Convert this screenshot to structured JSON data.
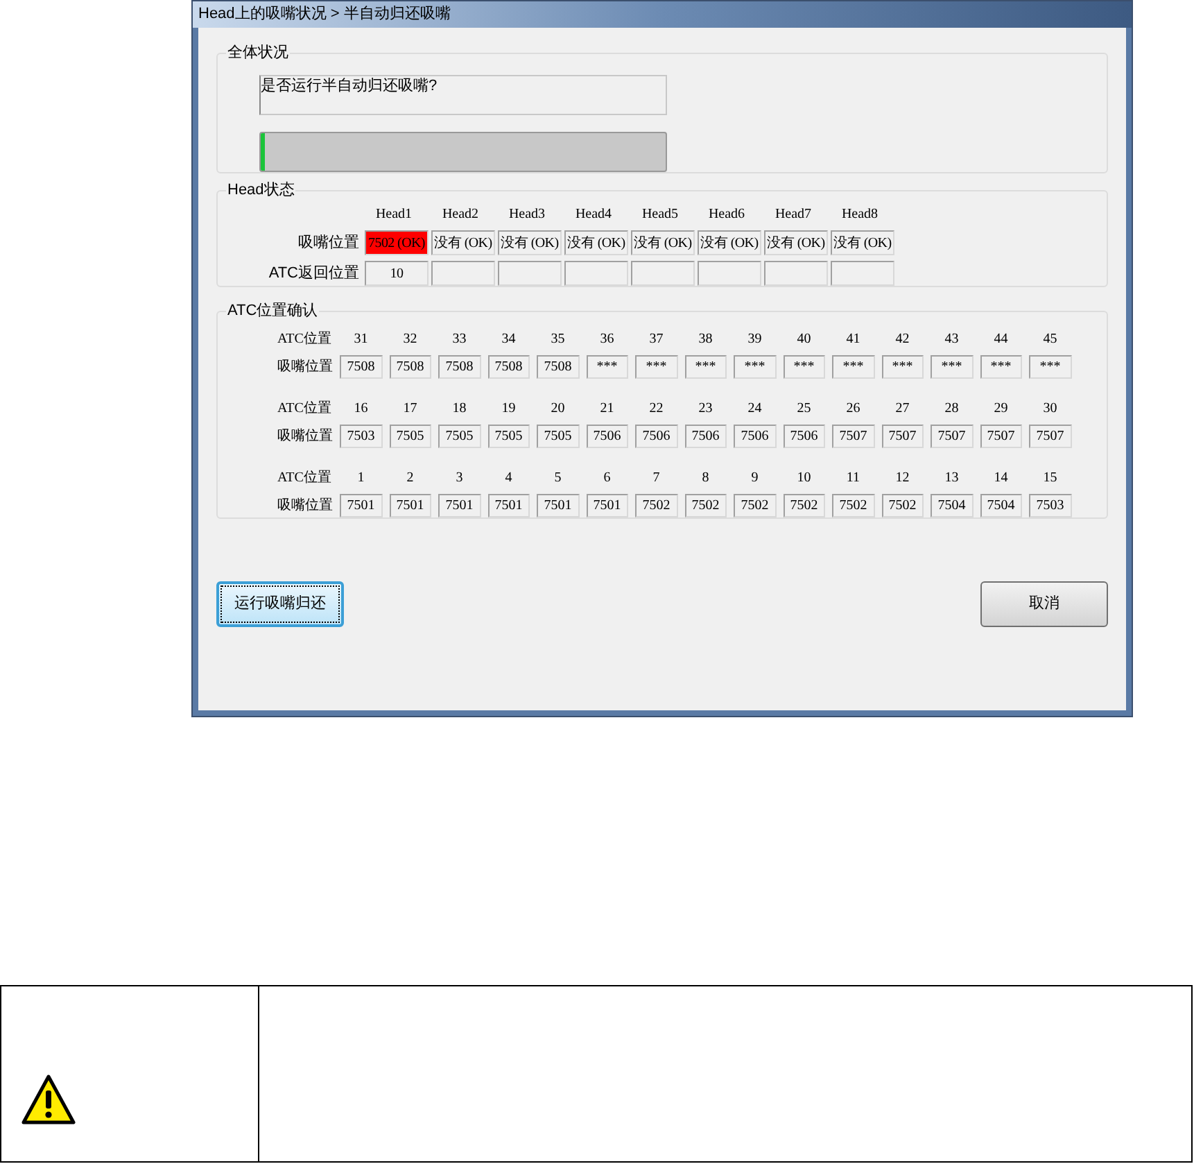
{
  "window": {
    "title": "Head上的吸嘴状况 > 半自动归还吸嘴"
  },
  "overall": {
    "label": "全体状况",
    "message": "是否运行半自动归还吸嘴?",
    "progress": {
      "level": 0.01
    }
  },
  "head_status": {
    "label": "Head状态",
    "row_labels": [
      "吸嘴位置",
      "ATC返回位置"
    ],
    "heads": [
      {
        "name": "Head1",
        "nozzle": "7502 (OK)",
        "alert": true,
        "atc_return": "10"
      },
      {
        "name": "Head2",
        "nozzle": "没有 (OK)",
        "alert": false
      },
      {
        "name": "Head3",
        "nozzle": "没有 (OK)",
        "alert": false
      },
      {
        "name": "Head4",
        "nozzle": "没有 (OK)",
        "alert": false
      },
      {
        "name": "Head5",
        "nozzle": "没有 (OK)",
        "alert": false
      },
      {
        "name": "Head6",
        "nozzle": "没有 (OK)",
        "alert": false
      },
      {
        "name": "Head7",
        "nozzle": "没有 (OK)",
        "alert": false
      },
      {
        "name": "Head8",
        "nozzle": "没有 (OK)",
        "alert": false
      }
    ]
  },
  "atc_check": {
    "label": "ATC位置确认",
    "groups": [
      {
        "atc_label": "ATC位置",
        "nozzle_label": "吸嘴位置",
        "slots": [
          {
            "atc": "31",
            "nozzle": "7508"
          },
          {
            "atc": "32",
            "nozzle": "7508"
          },
          {
            "atc": "33",
            "nozzle": "7508"
          },
          {
            "atc": "34",
            "nozzle": "7508"
          },
          {
            "atc": "35",
            "nozzle": "7508"
          },
          {
            "atc": "36",
            "nozzle": "***"
          },
          {
            "atc": "37",
            "nozzle": "***"
          },
          {
            "atc": "38",
            "nozzle": "***"
          },
          {
            "atc": "39",
            "nozzle": "***"
          },
          {
            "atc": "40",
            "nozzle": "***"
          },
          {
            "atc": "41",
            "nozzle": "***"
          },
          {
            "atc": "42",
            "nozzle": "***"
          },
          {
            "atc": "43",
            "nozzle": "***"
          },
          {
            "atc": "44",
            "nozzle": "***"
          },
          {
            "atc": "45",
            "nozzle": "***"
          }
        ]
      },
      {
        "atc_label": "ATC位置",
        "nozzle_label": "吸嘴位置",
        "slots": [
          {
            "atc": "16",
            "nozzle": "7503"
          },
          {
            "atc": "17",
            "nozzle": "7505"
          },
          {
            "atc": "18",
            "nozzle": "7505"
          },
          {
            "atc": "19",
            "nozzle": "7505"
          },
          {
            "atc": "20",
            "nozzle": "7505"
          },
          {
            "atc": "21",
            "nozzle": "7506"
          },
          {
            "atc": "22",
            "nozzle": "7506"
          },
          {
            "atc": "23",
            "nozzle": "7506"
          },
          {
            "atc": "24",
            "nozzle": "7506"
          },
          {
            "atc": "25",
            "nozzle": "7506"
          },
          {
            "atc": "26",
            "nozzle": "7507"
          },
          {
            "atc": "27",
            "nozzle": "7507"
          },
          {
            "atc": "28",
            "nozzle": "7507"
          },
          {
            "atc": "29",
            "nozzle": "7507"
          },
          {
            "atc": "30",
            "nozzle": "7507"
          }
        ]
      },
      {
        "atc_label": "ATC位置",
        "nozzle_label": "吸嘴位置",
        "slots": [
          {
            "atc": "1",
            "nozzle": "7501"
          },
          {
            "atc": "2",
            "nozzle": "7501"
          },
          {
            "atc": "3",
            "nozzle": "7501"
          },
          {
            "atc": "4",
            "nozzle": "7501"
          },
          {
            "atc": "5",
            "nozzle": "7501"
          },
          {
            "atc": "6",
            "nozzle": "7501"
          },
          {
            "atc": "7",
            "nozzle": "7502"
          },
          {
            "atc": "8",
            "nozzle": "7502"
          },
          {
            "atc": "9",
            "nozzle": "7502"
          },
          {
            "atc": "10",
            "nozzle": "7502"
          },
          {
            "atc": "11",
            "nozzle": "7502"
          },
          {
            "atc": "12",
            "nozzle": "7502"
          },
          {
            "atc": "13",
            "nozzle": "7504"
          },
          {
            "atc": "14",
            "nozzle": "7504"
          },
          {
            "atc": "15",
            "nozzle": "7503"
          }
        ]
      }
    ]
  },
  "buttons": [
    {
      "label": "运行吸嘴归还",
      "focused": true
    },
    {
      "label": "取消",
      "focused": false
    }
  ],
  "notice": {
    "kind": "warning"
  }
}
